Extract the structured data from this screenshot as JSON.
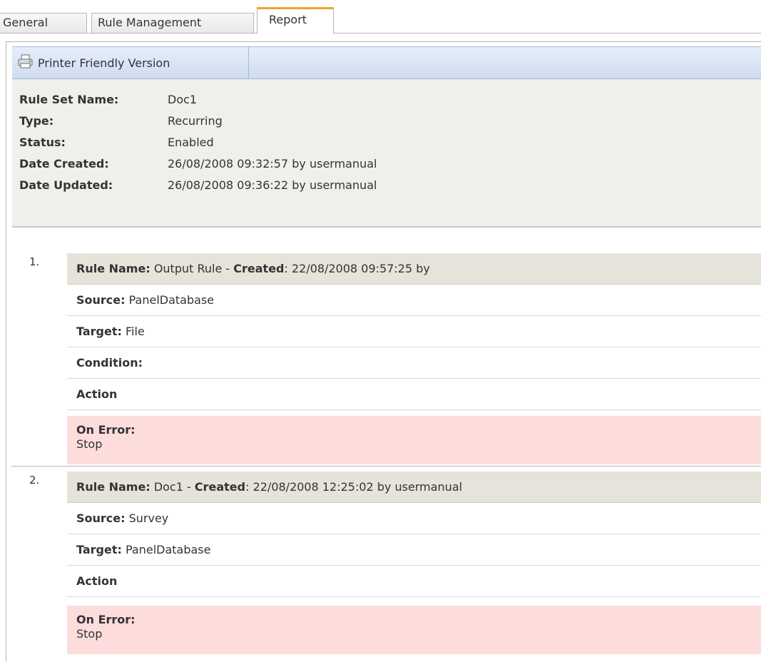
{
  "tabs": [
    "General",
    "Rule Management",
    "Report"
  ],
  "toolbar": {
    "print_label": "Printer Friendly Version",
    "print_icon": "printer-icon"
  },
  "summary": [
    {
      "label": "Rule Set Name:",
      "value": "Doc1"
    },
    {
      "label": "Type:",
      "value": "Recurring"
    },
    {
      "label": "Status:",
      "value": "Enabled"
    },
    {
      "label": "Date Created:",
      "value": "26/08/2008 09:32:57 by usermanual"
    },
    {
      "label": "Date Updated:",
      "value": "26/08/2008 09:36:22 by usermanual"
    }
  ],
  "rules": [
    {
      "number": "1.",
      "name_label": "Rule Name:",
      "name": " Output Rule - ",
      "created_label": "Created",
      "created": ": 22/08/2008 09:57:25 by",
      "source_label": "Source:",
      "source": " PanelDatabase",
      "target_label": "Target:",
      "target": " File",
      "condition_label": "Condition:",
      "action_label": "Action",
      "error_label": "On Error:",
      "error": "Stop"
    },
    {
      "number": "2.",
      "name_label": "Rule Name:",
      "name": " Doc1 - ",
      "created_label": "Created",
      "created": ": 22/08/2008 12:25:02 by usermanual",
      "source_label": "Source:",
      "source": " Survey",
      "target_label": "Target:",
      "target": " PanelDatabase",
      "action_label": "Action",
      "error_label": "On Error:",
      "error": "Stop"
    }
  ],
  "colors": {
    "active_tab_accent": "#f0a030",
    "summary_bg": "#efefec",
    "rule_header_bg": "#e5e3da",
    "error_bg": "#fddcdc",
    "toolbar_bg": "#cfdcf0"
  }
}
